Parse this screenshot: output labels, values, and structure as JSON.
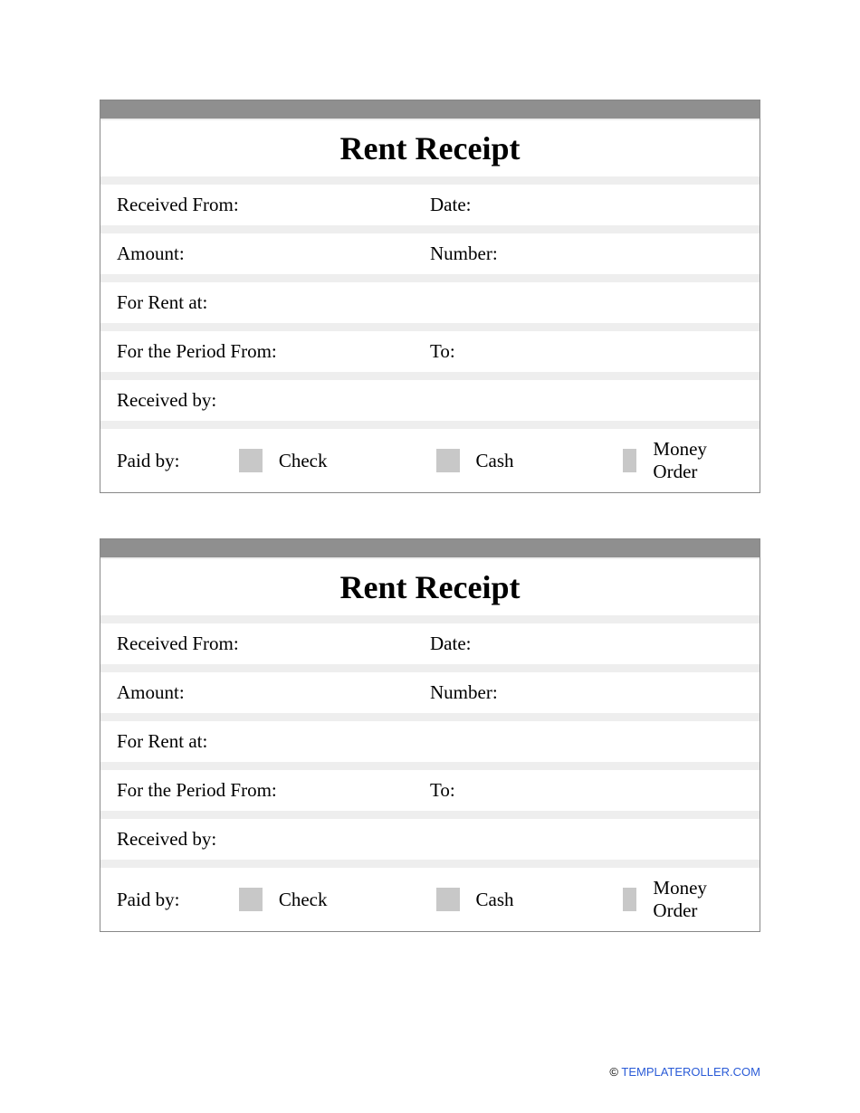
{
  "receipt": {
    "title": "Rent Receipt",
    "fields": {
      "received_from": "Received From:",
      "date": "Date:",
      "amount": "Amount:",
      "number": "Number:",
      "for_rent_at": "For Rent at:",
      "period_from": "For the Period From:",
      "to": "To:",
      "received_by": "Received by:",
      "paid_by": "Paid by:"
    },
    "payment_options": {
      "check": "Check",
      "cash": "Cash",
      "money_order": "Money Order"
    }
  },
  "footer": {
    "copyright": "©",
    "link_text": "TEMPLATEROLLER.COM"
  }
}
